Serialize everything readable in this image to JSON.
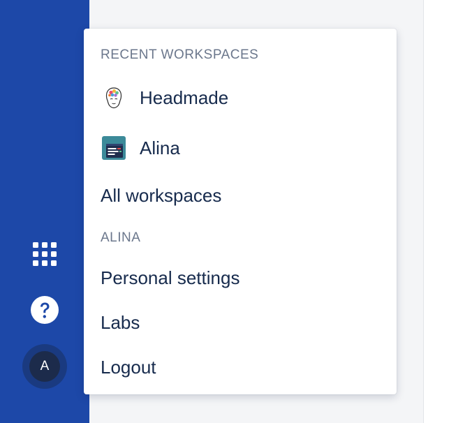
{
  "sidebar": {
    "app_switcher_icon": "app-switcher-grid-icon",
    "help_icon": "help-question-icon",
    "avatar_initial": "A",
    "background": "#1d48a8"
  },
  "dropdown": {
    "recent_heading": "RECENT WORKSPACES",
    "workspaces": [
      {
        "label": "Headmade",
        "icon": "headmade-logo"
      },
      {
        "label": "Alina",
        "icon": "alina-logo"
      }
    ],
    "all_workspaces_label": "All workspaces",
    "account_heading": "ALINA",
    "account_items": [
      {
        "label": "Personal settings"
      },
      {
        "label": "Labs"
      },
      {
        "label": "Logout"
      }
    ]
  },
  "colors": {
    "sidebar": "#1d48a8",
    "text_primary": "#172b4d",
    "text_secondary": "#6b778c",
    "content_bg": "#f4f5f7"
  }
}
